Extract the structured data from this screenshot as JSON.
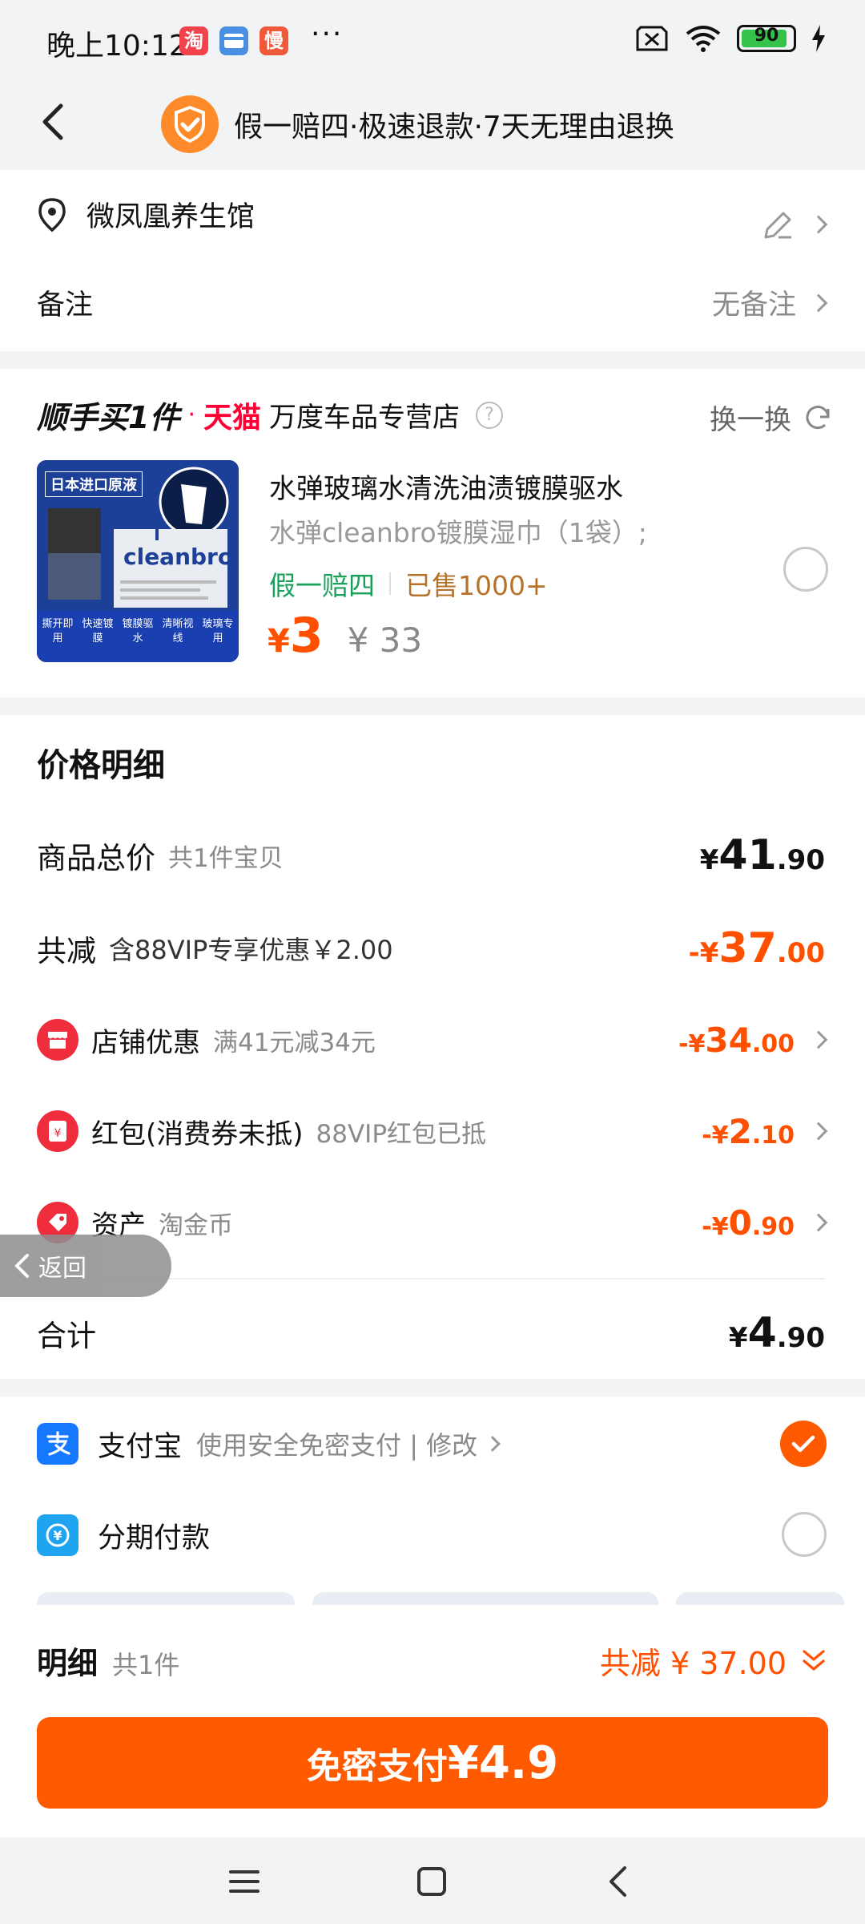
{
  "status_bar": {
    "time": "晚上10:12",
    "app_icons": [
      {
        "name": "taobao-icon",
        "glyph": "淘",
        "color": "#f2424b"
      },
      {
        "name": "card-icon",
        "glyph": "",
        "color": "#4a90e2"
      },
      {
        "name": "man-icon",
        "glyph": "慢",
        "color": "#ee5a3a"
      }
    ],
    "more": "···",
    "battery": "90"
  },
  "header": {
    "guarantee_text": "假一赔四·极速退款·7天无理由退换"
  },
  "address": {
    "name": "微凤凰养生馆",
    "note_label": "备注",
    "note_value": "无备注"
  },
  "product_section": {
    "brand": "顺手买1件",
    "dot": "·",
    "tmall": "天猫",
    "shop_name": "万度车品专营店",
    "question": "?",
    "swap_label": "换一换",
    "product": {
      "title": "水弹玻璃水清洗油渍镀膜驱水",
      "sku": "水弹cleanbro镀膜湿巾（1袋）;",
      "tag_guarantee": "假一赔四",
      "tag_sold": "已售1000+",
      "price_symbol": "¥",
      "price": "3",
      "original_price": "¥ 33",
      "image_text": {
        "banner": "日本进口原液",
        "brand": "cleanbro",
        "features": [
          "撕开即用",
          "快速镀膜",
          "镀膜驱水",
          "清晰视线",
          "玻璃专用"
        ]
      }
    }
  },
  "price_detail": {
    "title": "价格明细",
    "total": {
      "label": "商品总价",
      "sub": "共1件宝贝",
      "yen": "¥",
      "int": "41",
      "dec": ".90"
    },
    "reduce": {
      "label": "共减",
      "sub": "含88VIP专享优惠￥2.00",
      "yen": "-¥",
      "int": "37",
      "dec": ".00"
    },
    "shop_discount": {
      "label": "店铺优惠",
      "sub": "满41元减34元",
      "yen": "-¥",
      "int": "34",
      "dec": ".00"
    },
    "red_packet": {
      "label": "红包(消费券未抵)",
      "sub": "88VIP红包已抵",
      "yen": "-¥",
      "int": "2",
      "dec": ".10"
    },
    "assets": {
      "label": "资产",
      "sub": "淘金币",
      "yen": "-¥",
      "int": "0",
      "dec": ".90"
    },
    "sum": {
      "label": "合计",
      "yen": "¥",
      "int": "4",
      "dec": ".90"
    },
    "floating_back": "返回"
  },
  "payment": {
    "alipay_label": "支付宝",
    "alipay_sub": "使用安全免密支付 | 修改",
    "installment_label": "分期付款"
  },
  "bottom_bar": {
    "detail_label": "明细",
    "count": "共1件",
    "reduce_text": "共减 ¥ 37.00",
    "pay_button_text": "免密支付",
    "pay_amount": "¥4.9"
  },
  "colors": {
    "accent": "#ff5a00",
    "price": "#ff5000",
    "tmall": "#ff0036",
    "green": "#1aa05a"
  }
}
